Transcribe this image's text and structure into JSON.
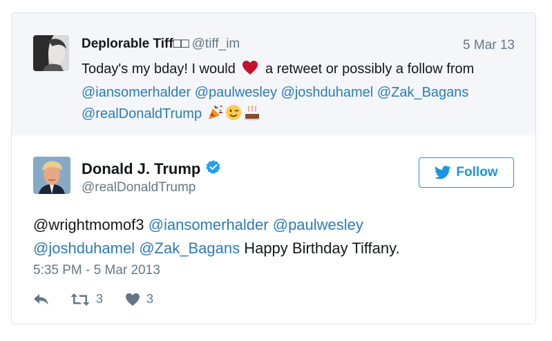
{
  "quoted_tweet": {
    "author_name": "Deplorable Tiff□□",
    "author_handle": "@tiff_im",
    "date": "5 Mar 13",
    "text_part1": "Today's my bday! I would",
    "text_part2": "a retweet or possibly a follow from",
    "mentions": [
      "@iansomerhalder",
      "@paulwesley",
      "@joshduhamel",
      "@Zak_Bagans",
      "@realDonaldTrump"
    ],
    "emojis": [
      "party-popper-icon",
      "winking-face-icon",
      "birthday-cake-icon"
    ],
    "heart_icon": "red-heart-icon"
  },
  "main_tweet": {
    "author_name": "Donald J. Trump",
    "author_handle": "@realDonaldTrump",
    "verified_icon": "verified-badge-icon",
    "follow_label": "Follow",
    "mentions": [
      "@wrightmomof3",
      "@iansomerhalder",
      "@paulwesley",
      "@joshduhamel",
      "@Zak_Bagans"
    ],
    "text": "Happy Birthday Tiffany.",
    "timestamp": "5:35 PM - 5 Mar 2013",
    "actions": {
      "reply_icon": "reply-icon",
      "retweet_icon": "retweet-icon",
      "retweet_count": "3",
      "like_icon": "heart-icon",
      "like_count": "3"
    }
  },
  "colors": {
    "link": "#2b7bb9",
    "twitter_blue": "#1b95e0",
    "secondary_text": "#657786",
    "quoted_background": "#f4f6f9"
  }
}
